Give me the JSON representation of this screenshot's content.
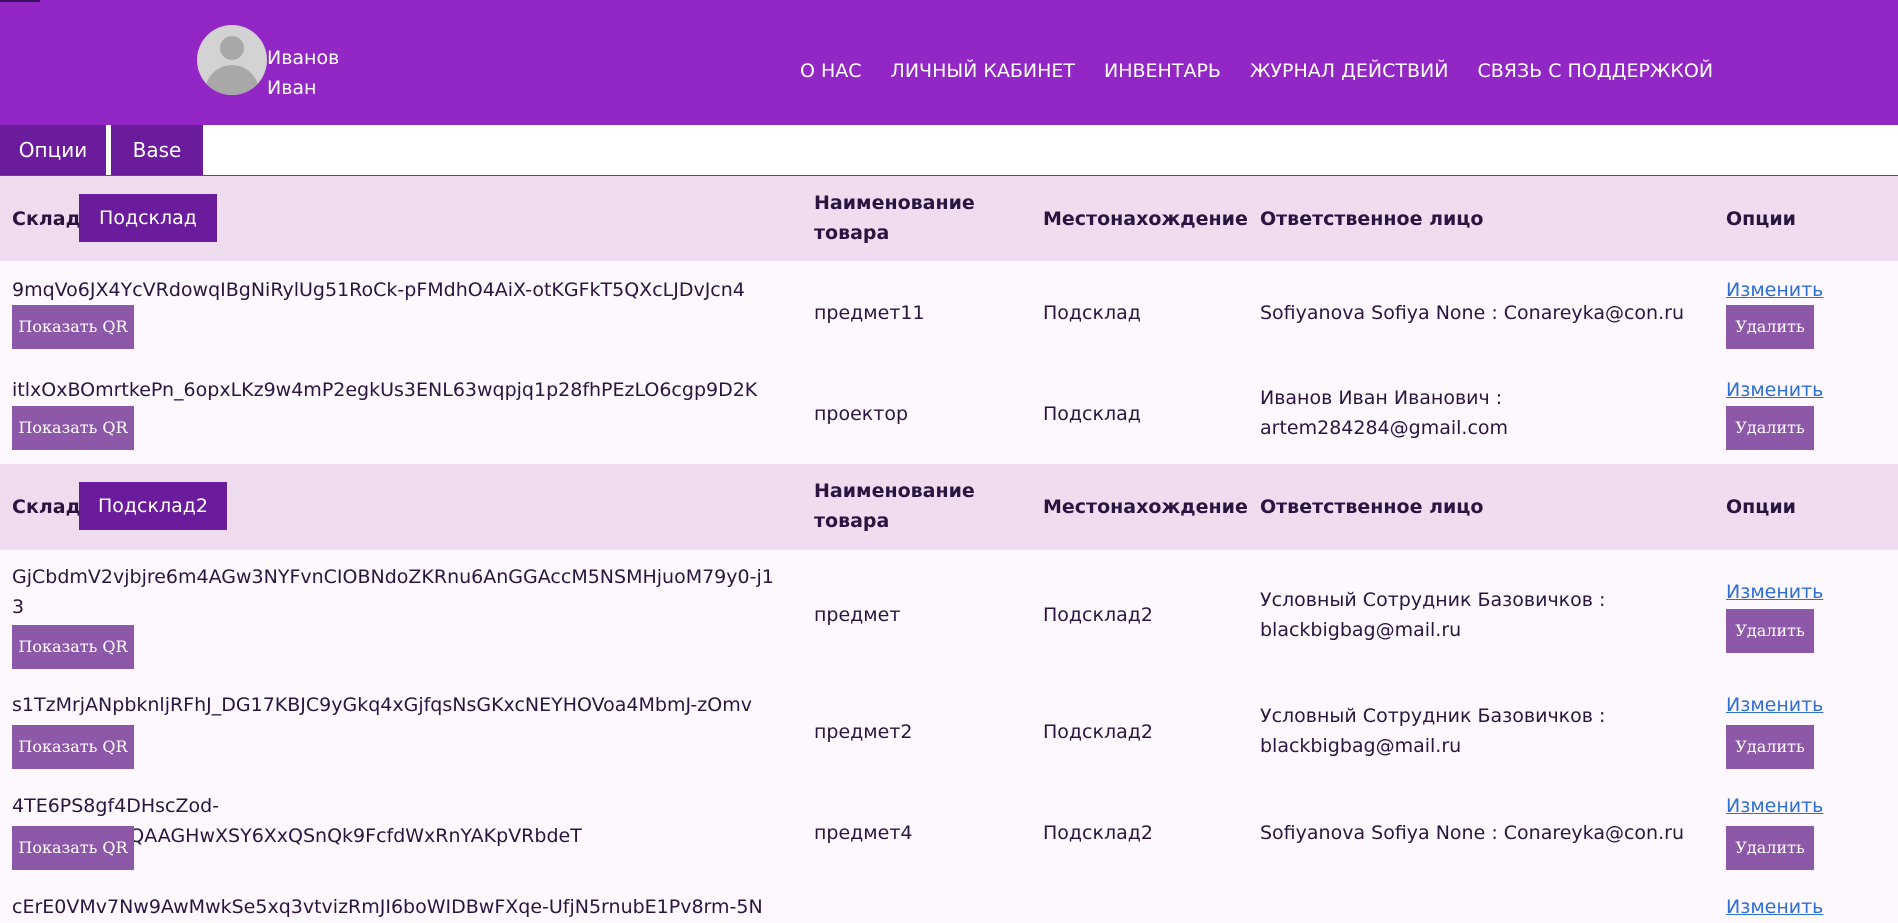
{
  "header": {
    "user_first": "Иванов",
    "user_last": "Иван",
    "nav": [
      "О НАС",
      "ЛИЧНЫЙ КАБИНЕТ",
      "ИНВЕНТАРЬ",
      "ЖУРНАЛ ДЕЙСТВИЙ",
      "СВЯЗЬ С ПОДДЕРЖКОЙ"
    ]
  },
  "tabs": [
    "Опции",
    "Base"
  ],
  "table": {
    "col_warehouse": "Склад",
    "col_name": "Наименование товара",
    "col_location": "Местонахождение",
    "col_responsible": "Ответственное лицо",
    "col_options": "Опции",
    "qr_label": "Показать QR",
    "edit_label": "Изменить",
    "delete_label": "Удалить"
  },
  "groups": [
    {
      "subwarehouse": "Подсклад",
      "items": [
        {
          "code": "9mqVo6JX4YcVRdowqIBgNiRylUg51RoCk-pFMdhO4AiX-otKGFkT5QXcLJDvJcn4",
          "name": "предмет11",
          "location": "Подсклад",
          "responsible": "Sofiyanova Sofiya None : Conareyka@con.ru"
        },
        {
          "code": "itlxOxBOmrtkePn_6opxLKz9w4mP2egkUs3ENL63wqpjq1p28fhPEzLO6cgp9D2K",
          "name": "проектор",
          "location": "Подсклад",
          "responsible": "Иванов Иван Иванович : artem284284@gmail.com"
        }
      ]
    },
    {
      "subwarehouse": "Подсклад2",
      "items": [
        {
          "code": "GjCbdmV2vjbjre6m4AGw3NYFvnCIOBNdoZKRnu6AnGGAccM5NSMHjuoM79y0-j13",
          "name": "предмет",
          "location": "Подсклад2",
          "responsible": "Условный Сотрудник Базовичков : blackbigbag@mail.ru"
        },
        {
          "code": "s1TzMrjANpbknljRFhJ_DG17KBJC9yGkq4xGjfqsNsGKxcNEYHOVoa4MbmJ-zOmv",
          "name": "предмет2",
          "location": "Подсклад2",
          "responsible": "Условный Сотрудник Базовичков : blackbigbag@mail.ru"
        },
        {
          "code": "4TE6PS8gf4DHscZod-52spzwRzvxQAAGHwXSY6XxQSnQk9FcfdWxRnYAKpVRbdeT",
          "name": "предмет4",
          "location": "Подсклад2",
          "responsible": "Sofiyanova Sofiya None : Conareyka@con.ru"
        },
        {
          "code": "cErE0VMv7Nw9AwMwkSe5xq3vtvizRmJI6boWIDBwFXqe-UfjN5rnubE1Pv8rm-5N",
          "name": "",
          "location": "",
          "responsible": ""
        }
      ]
    }
  ]
}
